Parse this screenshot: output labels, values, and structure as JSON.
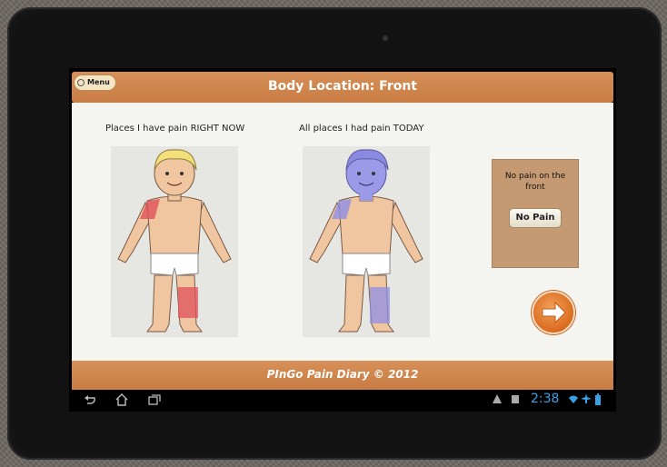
{
  "header": {
    "menu_label": "Menu",
    "title": "Body Location: Front"
  },
  "panels": {
    "current_label": "Places I have pain RIGHT NOW",
    "today_label": "All places I had pain TODAY"
  },
  "no_pain": {
    "text": "No pain on the front",
    "button_label": "No Pain"
  },
  "footer": {
    "text": "PInGo Pain Diary © 2012"
  },
  "status_bar": {
    "time": "2:38"
  },
  "colors": {
    "accent_orange": "#cd8249",
    "pain_now_red": "#e0505a",
    "pain_today_blue": "#8f8fe6",
    "time_blue": "#3aa0e6"
  },
  "icons": {
    "menu": "circle-icon",
    "next": "arrow-right-icon",
    "back": "back-icon",
    "home": "home-icon",
    "recent": "recent-apps-icon"
  }
}
